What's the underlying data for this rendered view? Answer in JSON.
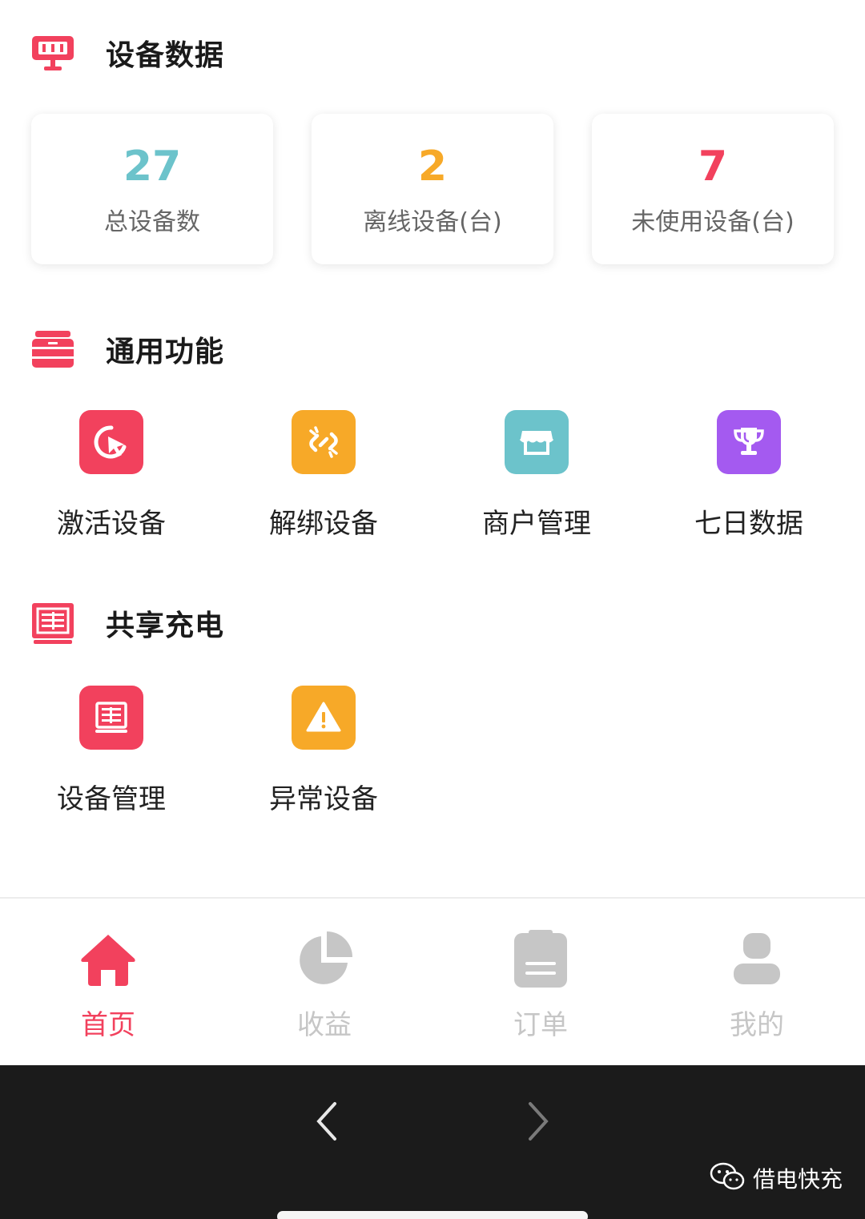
{
  "colors": {
    "accent": "#f2415d",
    "stat_total": "#6cc3cb",
    "stat_offline": "#f7a928",
    "stat_unused": "#f2415d",
    "icon_red": "#f2415d",
    "icon_orange": "#f7a928",
    "icon_teal": "#6cc3cb",
    "icon_purple": "#a45af0",
    "tab_inactive": "#c6c6c6"
  },
  "device_data": {
    "title": "设备数据",
    "icon": "monitor-icon",
    "stats": [
      {
        "value": "27",
        "label": "总设备数"
      },
      {
        "value": "2",
        "label": "离线设备(台)"
      },
      {
        "value": "7",
        "label": "未使用设备(台)"
      }
    ]
  },
  "general": {
    "title": "通用功能",
    "icon": "cabinet-icon",
    "items": [
      {
        "label": "激活设备",
        "icon": "activate-pointer-icon"
      },
      {
        "label": "解绑设备",
        "icon": "unlink-icon"
      },
      {
        "label": "商户管理",
        "icon": "storefront-icon"
      },
      {
        "label": "七日数据",
        "icon": "trophy-icon"
      }
    ]
  },
  "sharing": {
    "title": "共享充电",
    "icon": "device-list-icon",
    "items": [
      {
        "label": "设备管理",
        "icon": "device-list-icon"
      },
      {
        "label": "异常设备",
        "icon": "warning-icon"
      }
    ]
  },
  "tabbar": {
    "items": [
      {
        "label": "首页",
        "icon": "home-icon",
        "active": true
      },
      {
        "label": "收益",
        "icon": "pie-chart-icon",
        "active": false
      },
      {
        "label": "订单",
        "icon": "clipboard-icon",
        "active": false
      },
      {
        "label": "我的",
        "icon": "user-icon",
        "active": false
      }
    ]
  },
  "watermark": {
    "name": "借电快充",
    "icon": "wechat-icon"
  }
}
